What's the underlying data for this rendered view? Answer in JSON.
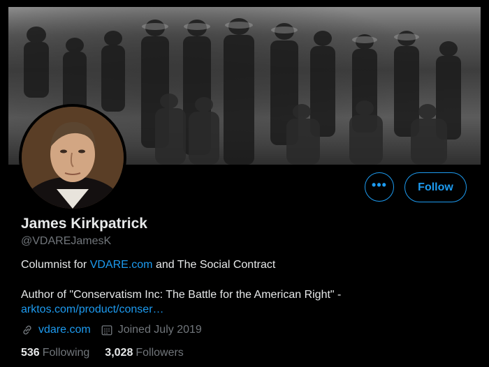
{
  "profile": {
    "name": "James Kirkpatrick",
    "handle": "@VDAREJamesK",
    "bio_line1_prefix": "Columnist for ",
    "bio_line1_link": "VDARE.com",
    "bio_line1_suffix": " and The Social Contract",
    "bio_line2": "Author of \"Conservatism Inc: The Battle for the American Right\" -",
    "bio_line2_link": "arktos.com/product/conser…",
    "website": "vdare.com",
    "joined": "Joined July 2019",
    "following_count": "536",
    "following_label": "Following",
    "followers_count": "3,028",
    "followers_label": "Followers"
  },
  "buttons": {
    "more_label": "•••",
    "follow_label": "Follow"
  },
  "icons": {
    "more": "more-icon",
    "link": "link-icon",
    "calendar": "calendar-icon"
  },
  "colors": {
    "accent": "#1d9bf0",
    "background": "#000000",
    "text": "#e7e9ea",
    "muted": "#71767b"
  }
}
